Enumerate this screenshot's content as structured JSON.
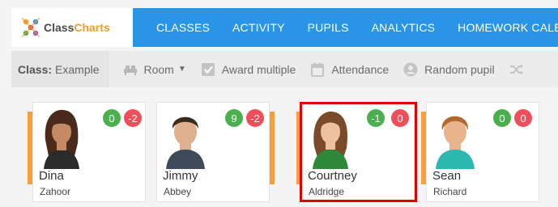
{
  "app": {
    "logo_part1": "Class",
    "logo_part2": "Charts"
  },
  "nav": {
    "items": [
      {
        "label": "CLASSES"
      },
      {
        "label": "ACTIVITY"
      },
      {
        "label": "PUPILS"
      },
      {
        "label": "ANALYTICS"
      },
      {
        "label": "HOMEWORK CALENDAR"
      }
    ]
  },
  "toolbar": {
    "class_label": "Class:",
    "class_value": "Example",
    "room": "Room",
    "award_multiple": "Award multiple",
    "attendance": "Attendance",
    "random_pupil": "Random pupil"
  },
  "pupils": [
    {
      "first": "Dina",
      "last": "Zahoor",
      "positive": "0",
      "negative": "-2"
    },
    {
      "first": "Jimmy",
      "last": "Abbey",
      "positive": "9",
      "negative": "-2"
    },
    {
      "first": "Courtney",
      "last": "Aldridge",
      "positive": "-1",
      "negative": "0"
    },
    {
      "first": "Sean",
      "last": "Richard",
      "positive": "0",
      "negative": "0"
    }
  ],
  "colors": {
    "nav_bg": "#2a95e6",
    "accent_orange": "#f5a03a",
    "positive_badge": "#4bae4f",
    "negative_badge": "#ef4f5a",
    "highlight": "#e10000"
  }
}
